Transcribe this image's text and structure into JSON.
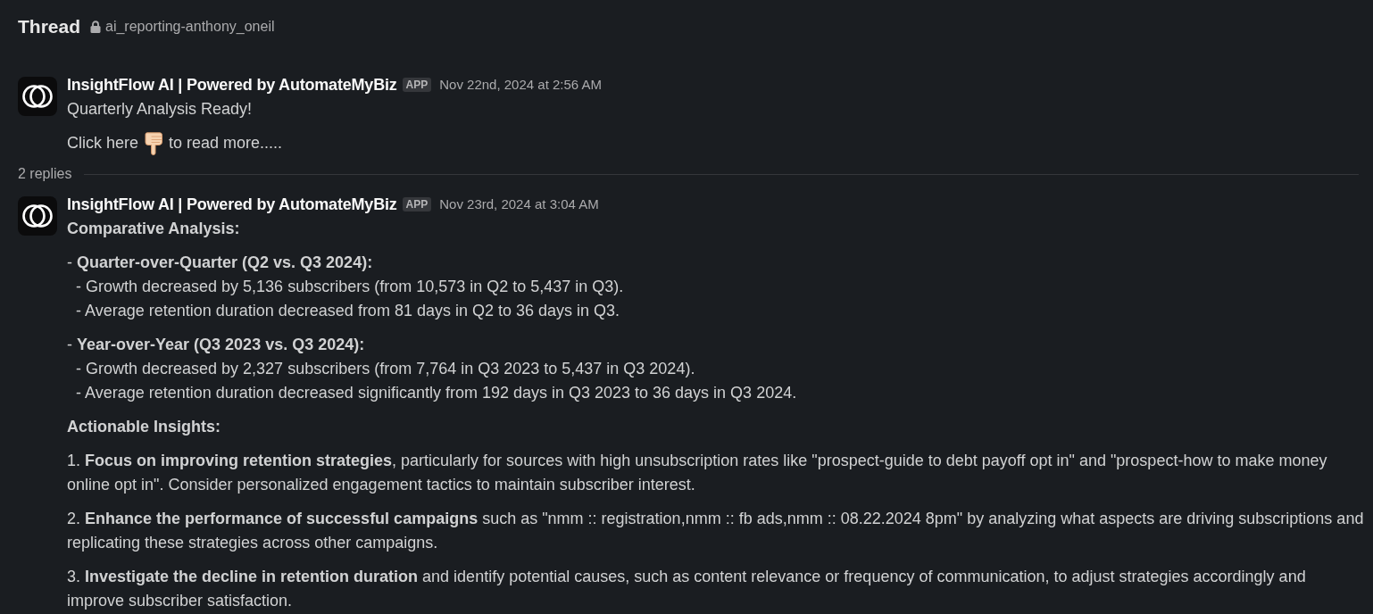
{
  "header": {
    "title": "Thread",
    "private": true,
    "channel": "ai_reporting-anthony_oneil"
  },
  "parent_message": {
    "sender": "InsightFlow AI | Powered by AutomateMyBiz",
    "badge": "APP",
    "timestamp": "Nov 22nd, 2024 at 2:56 AM",
    "blocks": [
      {
        "kind": "text",
        "text": "Quarterly Analysis Ready!"
      },
      {
        "kind": "emoji_line",
        "before": "Click here",
        "after": "to read more....."
      }
    ]
  },
  "replies_count": "2 replies",
  "replies": [
    {
      "sender": "InsightFlow AI | Powered by AutomateMyBiz",
      "badge": "APP",
      "timestamp": "Nov 23rd, 2024 at 3:04 AM",
      "blocks": [
        {
          "kind": "heading",
          "text": "Comparative Analysis:"
        },
        {
          "kind": "list_item",
          "text": "- **Quarter-over-Quarter (Q2 vs. Q3 2024):**",
          "children": [
            {
              "text": "- Growth decreased by 5,136 subscribers (from 10,573 in Q2 to 5,437 in Q3)."
            },
            {
              "text": "- Average retention duration decreased from 81 days in Q2 to 36 days in Q3."
            }
          ]
        },
        {
          "kind": "list_item",
          "text": "- **Year-over-Year (Q3 2023 vs. Q3 2024):**",
          "children": [
            {
              "text": "- Growth decreased by 2,327 subscribers (from 7,764 in Q3 2023 to 5,437 in Q3 2024)."
            },
            {
              "text": "- Average retention duration decreased significantly from 192 days in Q3 2023 to 36 days in Q3 2024."
            }
          ]
        },
        {
          "kind": "heading",
          "text": "Actionable Insights:"
        },
        {
          "kind": "paragraph",
          "text": "1. **Focus on improving retention strategies**, particularly for sources with high unsubscription rates like \"prospect-guide to debt payoff opt in\" and \"prospect-how to make money online opt in\". Consider personalized engagement tactics to maintain subscriber interest."
        },
        {
          "kind": "paragraph",
          "text": "2. **Enhance the performance of successful campaigns** such as \"nmm :: registration,nmm :: fb ads,nmm :: 08.22.2024 8pm\" by analyzing what aspects are driving subscriptions and replicating these strategies across other campaigns."
        },
        {
          "kind": "paragraph",
          "text": "3. **Investigate the decline in retention duration** and identify potential causes, such as content relevance or frequency of communication, to adjust strategies accordingly and improve subscriber satisfaction."
        }
      ]
    }
  ]
}
